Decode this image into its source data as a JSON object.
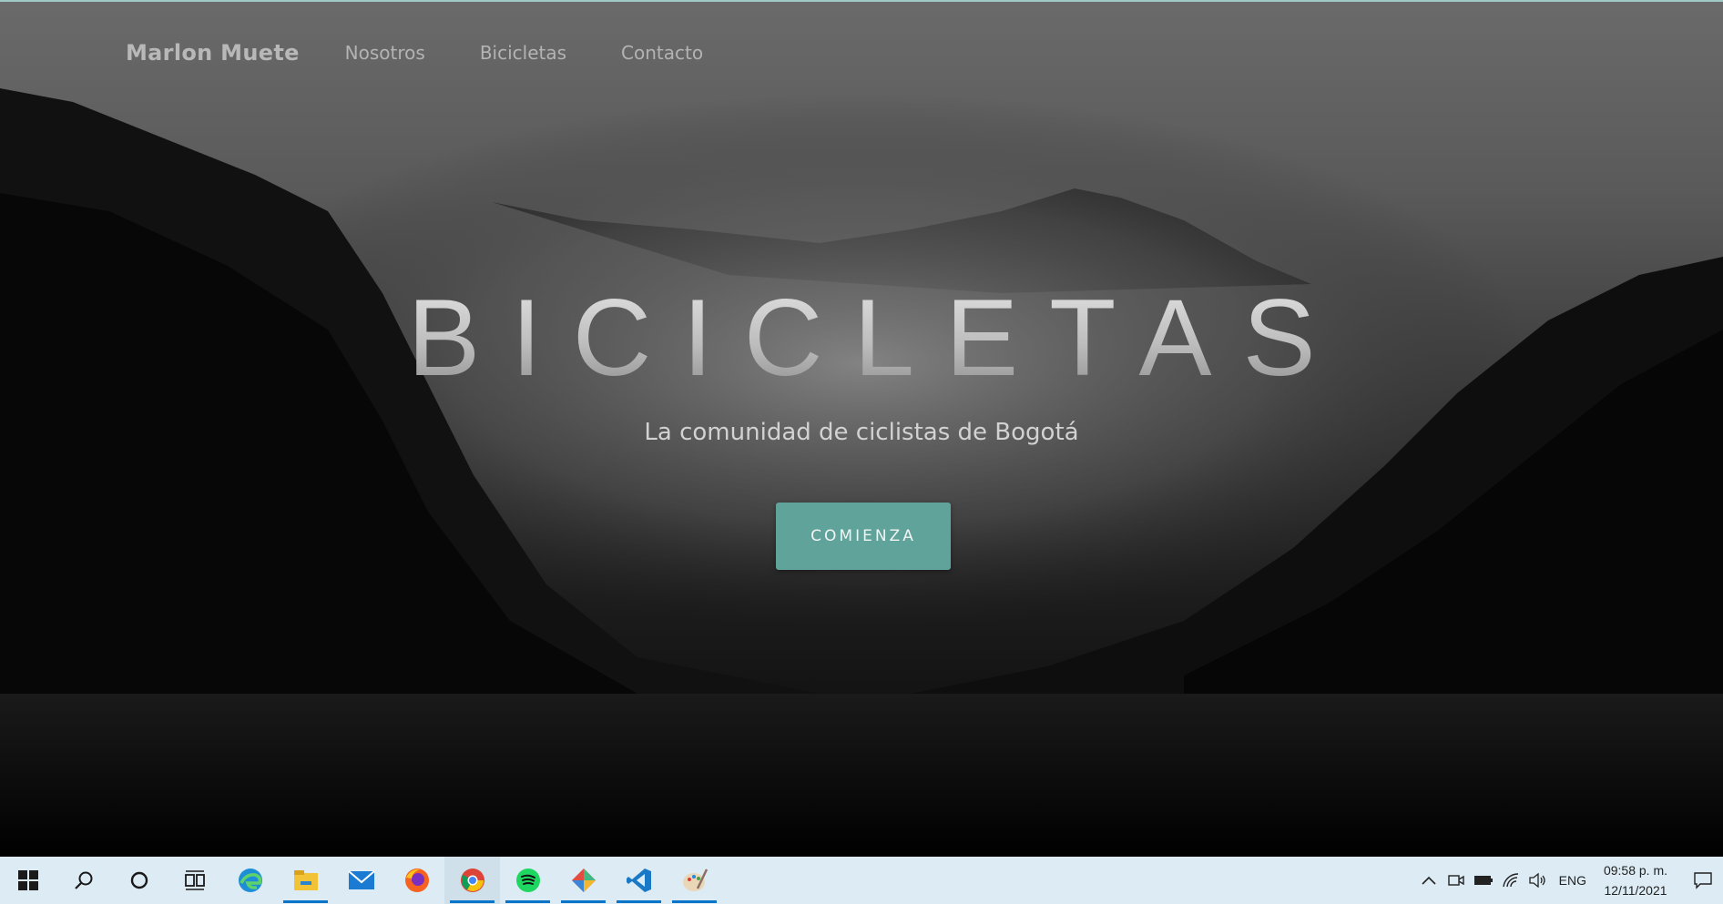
{
  "nav": {
    "brand": "Marlon Muete",
    "links": [
      "Nosotros",
      "Bicicletas",
      "Contacto"
    ]
  },
  "hero": {
    "title": "BICICLETAS",
    "subtitle": "La comunidad de ciclistas de Bogotá",
    "cta_label": "COMIENZA"
  },
  "colors": {
    "accent": "#5fa39a",
    "taskbar": "#dcebf4"
  },
  "taskbar": {
    "apps": [
      {
        "icon": "windows-start-icon"
      },
      {
        "icon": "search-icon"
      },
      {
        "icon": "cortana-icon"
      },
      {
        "icon": "task-view-icon"
      },
      {
        "icon": "edge-icon"
      },
      {
        "icon": "file-explorer-icon"
      },
      {
        "icon": "mail-icon"
      },
      {
        "icon": "firefox-icon"
      },
      {
        "icon": "chrome-icon"
      },
      {
        "icon": "spotify-icon"
      },
      {
        "icon": "gitkraken-icon"
      },
      {
        "icon": "vscode-icon"
      },
      {
        "icon": "paint-icon"
      }
    ],
    "tray": {
      "language": "ENG",
      "time": "09:58 p. m.",
      "date": "12/11/2021"
    }
  }
}
